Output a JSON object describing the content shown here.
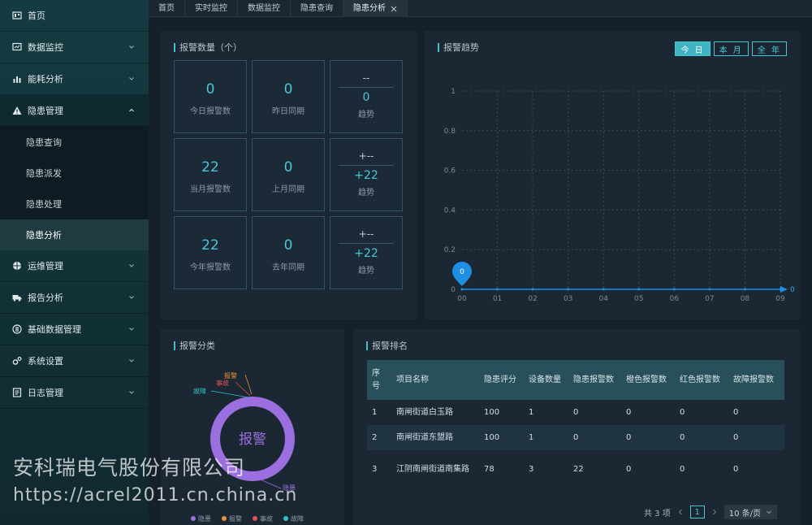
{
  "sidebar": {
    "items": [
      {
        "label": "首页",
        "icon": "home-icon"
      },
      {
        "label": "数据监控",
        "icon": "monitor-icon"
      },
      {
        "label": "能耗分析",
        "icon": "bar-chart-icon"
      },
      {
        "label": "隐患管理",
        "icon": "warning-icon"
      },
      {
        "label": "运维管理",
        "icon": "globe-icon"
      },
      {
        "label": "报告分析",
        "icon": "truck-icon"
      },
      {
        "label": "基础数据管理",
        "icon": "database-icon"
      },
      {
        "label": "系统设置",
        "icon": "gears-icon"
      },
      {
        "label": "日志管理",
        "icon": "log-icon"
      }
    ],
    "sub_items": [
      "隐患查询",
      "隐患派发",
      "隐患处理",
      "隐患分析"
    ]
  },
  "tabs": [
    "首页",
    "实时监控",
    "数据监控",
    "隐患查询",
    "隐患分析"
  ],
  "count_panel": {
    "title": "报警数量（个）",
    "cells": [
      {
        "value": "0",
        "label": "今日报警数"
      },
      {
        "value": "0",
        "label": "昨日同期"
      },
      {
        "top": "--",
        "value": "0",
        "label": "趋势"
      },
      {
        "value": "22",
        "label": "当月报警数"
      },
      {
        "value": "0",
        "label": "上月同期"
      },
      {
        "top": "+--",
        "value": "+22",
        "label": "趋势"
      },
      {
        "value": "22",
        "label": "今年报警数"
      },
      {
        "value": "0",
        "label": "去年同期"
      },
      {
        "top": "+--",
        "value": "+22",
        "label": "趋势"
      }
    ]
  },
  "trend_panel": {
    "title": "报警趋势",
    "buttons": [
      "今 日",
      "本 月",
      "全 年"
    ]
  },
  "category_panel": {
    "title": "报警分类"
  },
  "ranking_panel": {
    "title": "报警排名",
    "headers": [
      "序号",
      "项目名称",
      "隐患评分",
      "设备数量",
      "隐患报警数",
      "橙色报警数",
      "红色报警数",
      "故障报警数"
    ],
    "rows": [
      [
        "1",
        "南闸街道白玉路",
        "100",
        "1",
        "0",
        "0",
        "0",
        "0"
      ],
      [
        "2",
        "南闸街道东盟路",
        "100",
        "1",
        "0",
        "0",
        "0",
        "0"
      ],
      [
        "3",
        "江阴南闸街道南集路",
        "78",
        "3",
        "22",
        "0",
        "0",
        "0"
      ]
    ],
    "pager": {
      "total": "共 3 项",
      "page": "1",
      "size": "10 条/页"
    }
  },
  "chart_data": [
    {
      "type": "line",
      "x": [
        "00",
        "01",
        "02",
        "03",
        "04",
        "05",
        "06",
        "07",
        "08",
        "09"
      ],
      "series": [
        {
          "values": [
            0,
            0,
            0,
            0,
            0,
            0,
            0,
            0,
            0,
            0
          ]
        }
      ],
      "ylim": [
        0,
        1
      ],
      "yticks": [
        "0",
        "0.2",
        "0.4",
        "0.6",
        "0.8",
        "1"
      ],
      "marker_label": "0",
      "end_label": "0",
      "grid": true,
      "color": "#1f8fe6"
    },
    {
      "type": "pie",
      "center_label": "报警",
      "categories": [
        "隐患",
        "报警",
        "事故",
        "故障"
      ],
      "values": [
        22,
        0,
        0,
        0
      ],
      "colors": [
        "#9b6fe0",
        "#e8913b",
        "#e05353",
        "#2fc6c9"
      ],
      "legend": "bottom"
    }
  ],
  "watermark": {
    "line1": "安科瑞电气股份有限公司",
    "line2": "https://acrel2011.cn.china.cn"
  }
}
